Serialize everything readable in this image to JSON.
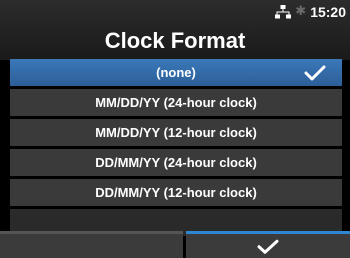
{
  "status": {
    "network_icon": "network-icon",
    "bluetooth_icon": "bluetooth-icon",
    "bluetooth_glyph": "✱",
    "time": "15:20"
  },
  "header": {
    "title": "Clock Format"
  },
  "options": [
    {
      "label": "(none)",
      "selected": true
    },
    {
      "label": "MM/DD/YY (24-hour clock)",
      "selected": false
    },
    {
      "label": "MM/DD/YY (12-hour clock)",
      "selected": false
    },
    {
      "label": "DD/MM/YY (24-hour clock)",
      "selected": false
    },
    {
      "label": "DD/MM/YY (12-hour clock)",
      "selected": false
    }
  ],
  "footer": {
    "confirm_icon": "checkmark-icon"
  },
  "colors": {
    "accent": "#2f87d3",
    "selected_row": "#2c5f99",
    "row": "#3a3a3a"
  }
}
